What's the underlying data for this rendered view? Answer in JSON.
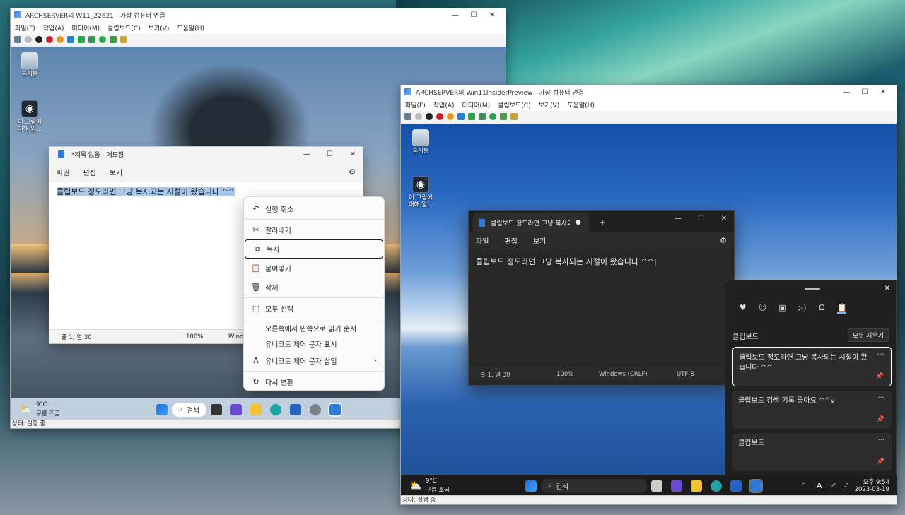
{
  "vm1": {
    "title": "ARCHSERVER의 W11_22621 - 가상 컴퓨터 연결",
    "menu": [
      "파일(F)",
      "작업(A)",
      "미디어(M)",
      "클립보드(C)",
      "보기(V)",
      "도움말(H)"
    ],
    "status": "상태: 실행 중",
    "desktop_icons": [
      "휴지통",
      "이 그림에 대해 알..."
    ],
    "notepad": {
      "title": "*제목 없음 - 메모장",
      "menu": [
        "파일",
        "편집",
        "보기"
      ],
      "text": "클립보드 정도라면 그냥 복사되는 시절이 왔습니다 ^^",
      "status_pos": "줄 1, 열 30",
      "status_zoom": "100%",
      "status_eol": "Windo"
    },
    "context_menu": {
      "items": [
        "실행 취소",
        "잘라내기",
        "복사",
        "붙여넣기",
        "삭제",
        "모두 선택",
        "오른쪽에서 왼쪽으로 읽기 순서",
        "유니코드 제어 문자 표시",
        "유니코드 제어 문자 삽입",
        "다시 변환"
      ]
    },
    "taskbar": {
      "weather_temp": "9°C",
      "weather_desc": "구름 조금",
      "search": "검색"
    }
  },
  "vm2": {
    "title": "ARCHSERVER의 Win11InsiderPreview - 가상 컴퓨터 연결",
    "menu": [
      "파일(F)",
      "작업(A)",
      "미디어(M)",
      "클립보드(C)",
      "보기(V)",
      "도움말(H)"
    ],
    "status": "상태: 실행 중",
    "desktop_icons": [
      "휴지통",
      "이 그림에 대해 알..."
    ],
    "notepad": {
      "tab_title": "클립보드 정도라면 그냥 복사되는 시",
      "new_tab": "+",
      "menu": [
        "파일",
        "편집",
        "보기"
      ],
      "text": "클립보드 정도라면 그냥 복사되는 시절이 왔습니다 ^^",
      "status_pos": "줄 1, 열 30",
      "status_zoom": "100%",
      "status_eol": "Windows (CRLF)",
      "status_enc": "UTF-8"
    },
    "clipboard": {
      "heading": "클립보드",
      "clear_all": "모두 지우기",
      "items": [
        "클립보드 정도라면 그냥 복사되는 시절이 왔습니다 ^^",
        "클립보드 검색 기록 좋아요 ^^v",
        "클립보드"
      ]
    },
    "taskbar": {
      "weather_temp": "9°C",
      "weather_desc": "구름 조금",
      "search": "검색",
      "time": "오후 9:54",
      "date": "2023-03-19"
    }
  }
}
